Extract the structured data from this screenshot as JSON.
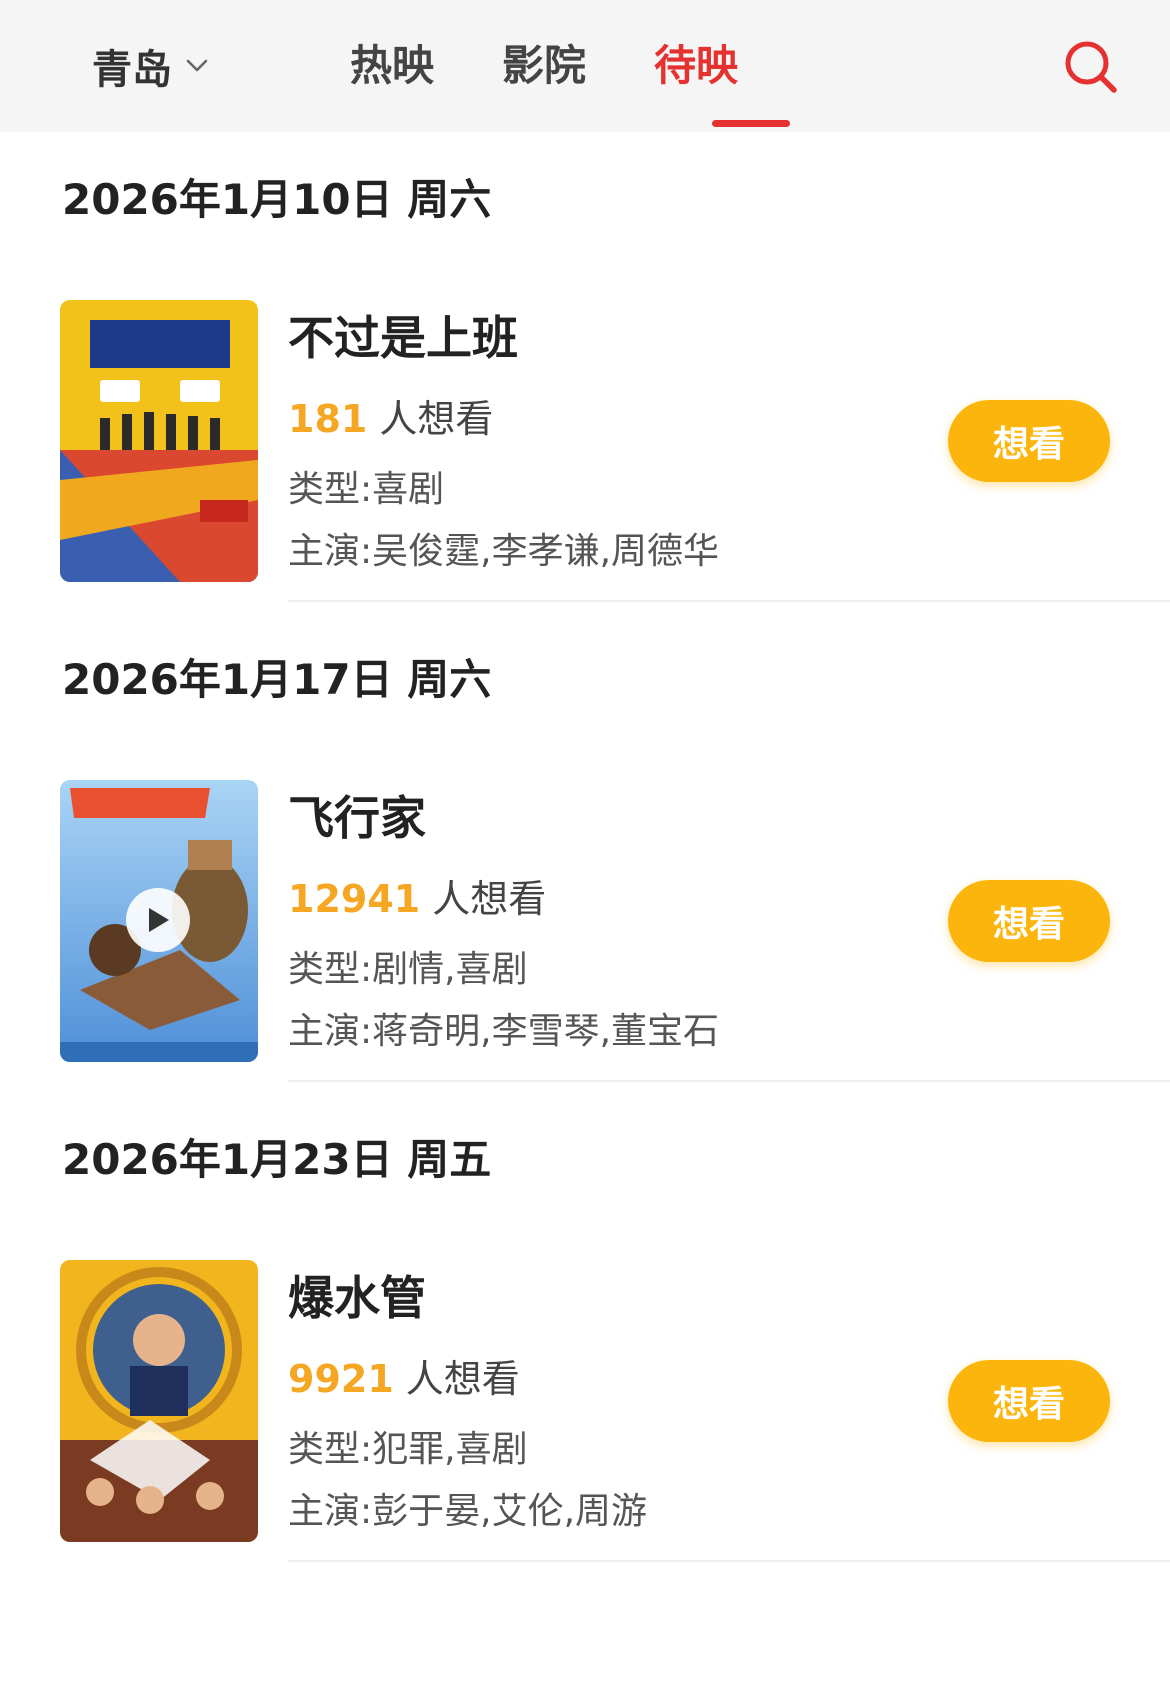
{
  "header": {
    "city": "青岛",
    "tabs": [
      {
        "label": "热映",
        "active": false
      },
      {
        "label": "影院",
        "active": false
      },
      {
        "label": "待映",
        "active": true
      }
    ],
    "accent_color": "#e5312f",
    "search_icon": "search-icon"
  },
  "sections": [
    {
      "date": "2026年1月10日 周六",
      "movie": {
        "title": "不过是上班",
        "want_count": "181",
        "want_suffix": "人想看",
        "genre": "类型:喜剧",
        "cast": "主演:吴俊霆,李孝谦,周德华",
        "button": "想看"
      }
    },
    {
      "date": "2026年1月17日 周六",
      "movie": {
        "title": "飞行家",
        "want_count": "12941",
        "want_suffix": "人想看",
        "genre": "类型:剧情,喜剧",
        "cast": "主演:蒋奇明,李雪琴,董宝石",
        "button": "想看"
      }
    },
    {
      "date": "2026年1月23日 周五",
      "movie": {
        "title": "爆水管",
        "want_count": "9921",
        "want_suffix": "人想看",
        "genre": "类型:犯罪,喜剧",
        "cast": "主演:彭于晏,艾伦,周游",
        "button": "想看"
      }
    }
  ],
  "colors": {
    "want_count": "#f5a623",
    "button_bg": "#fbb50c"
  }
}
